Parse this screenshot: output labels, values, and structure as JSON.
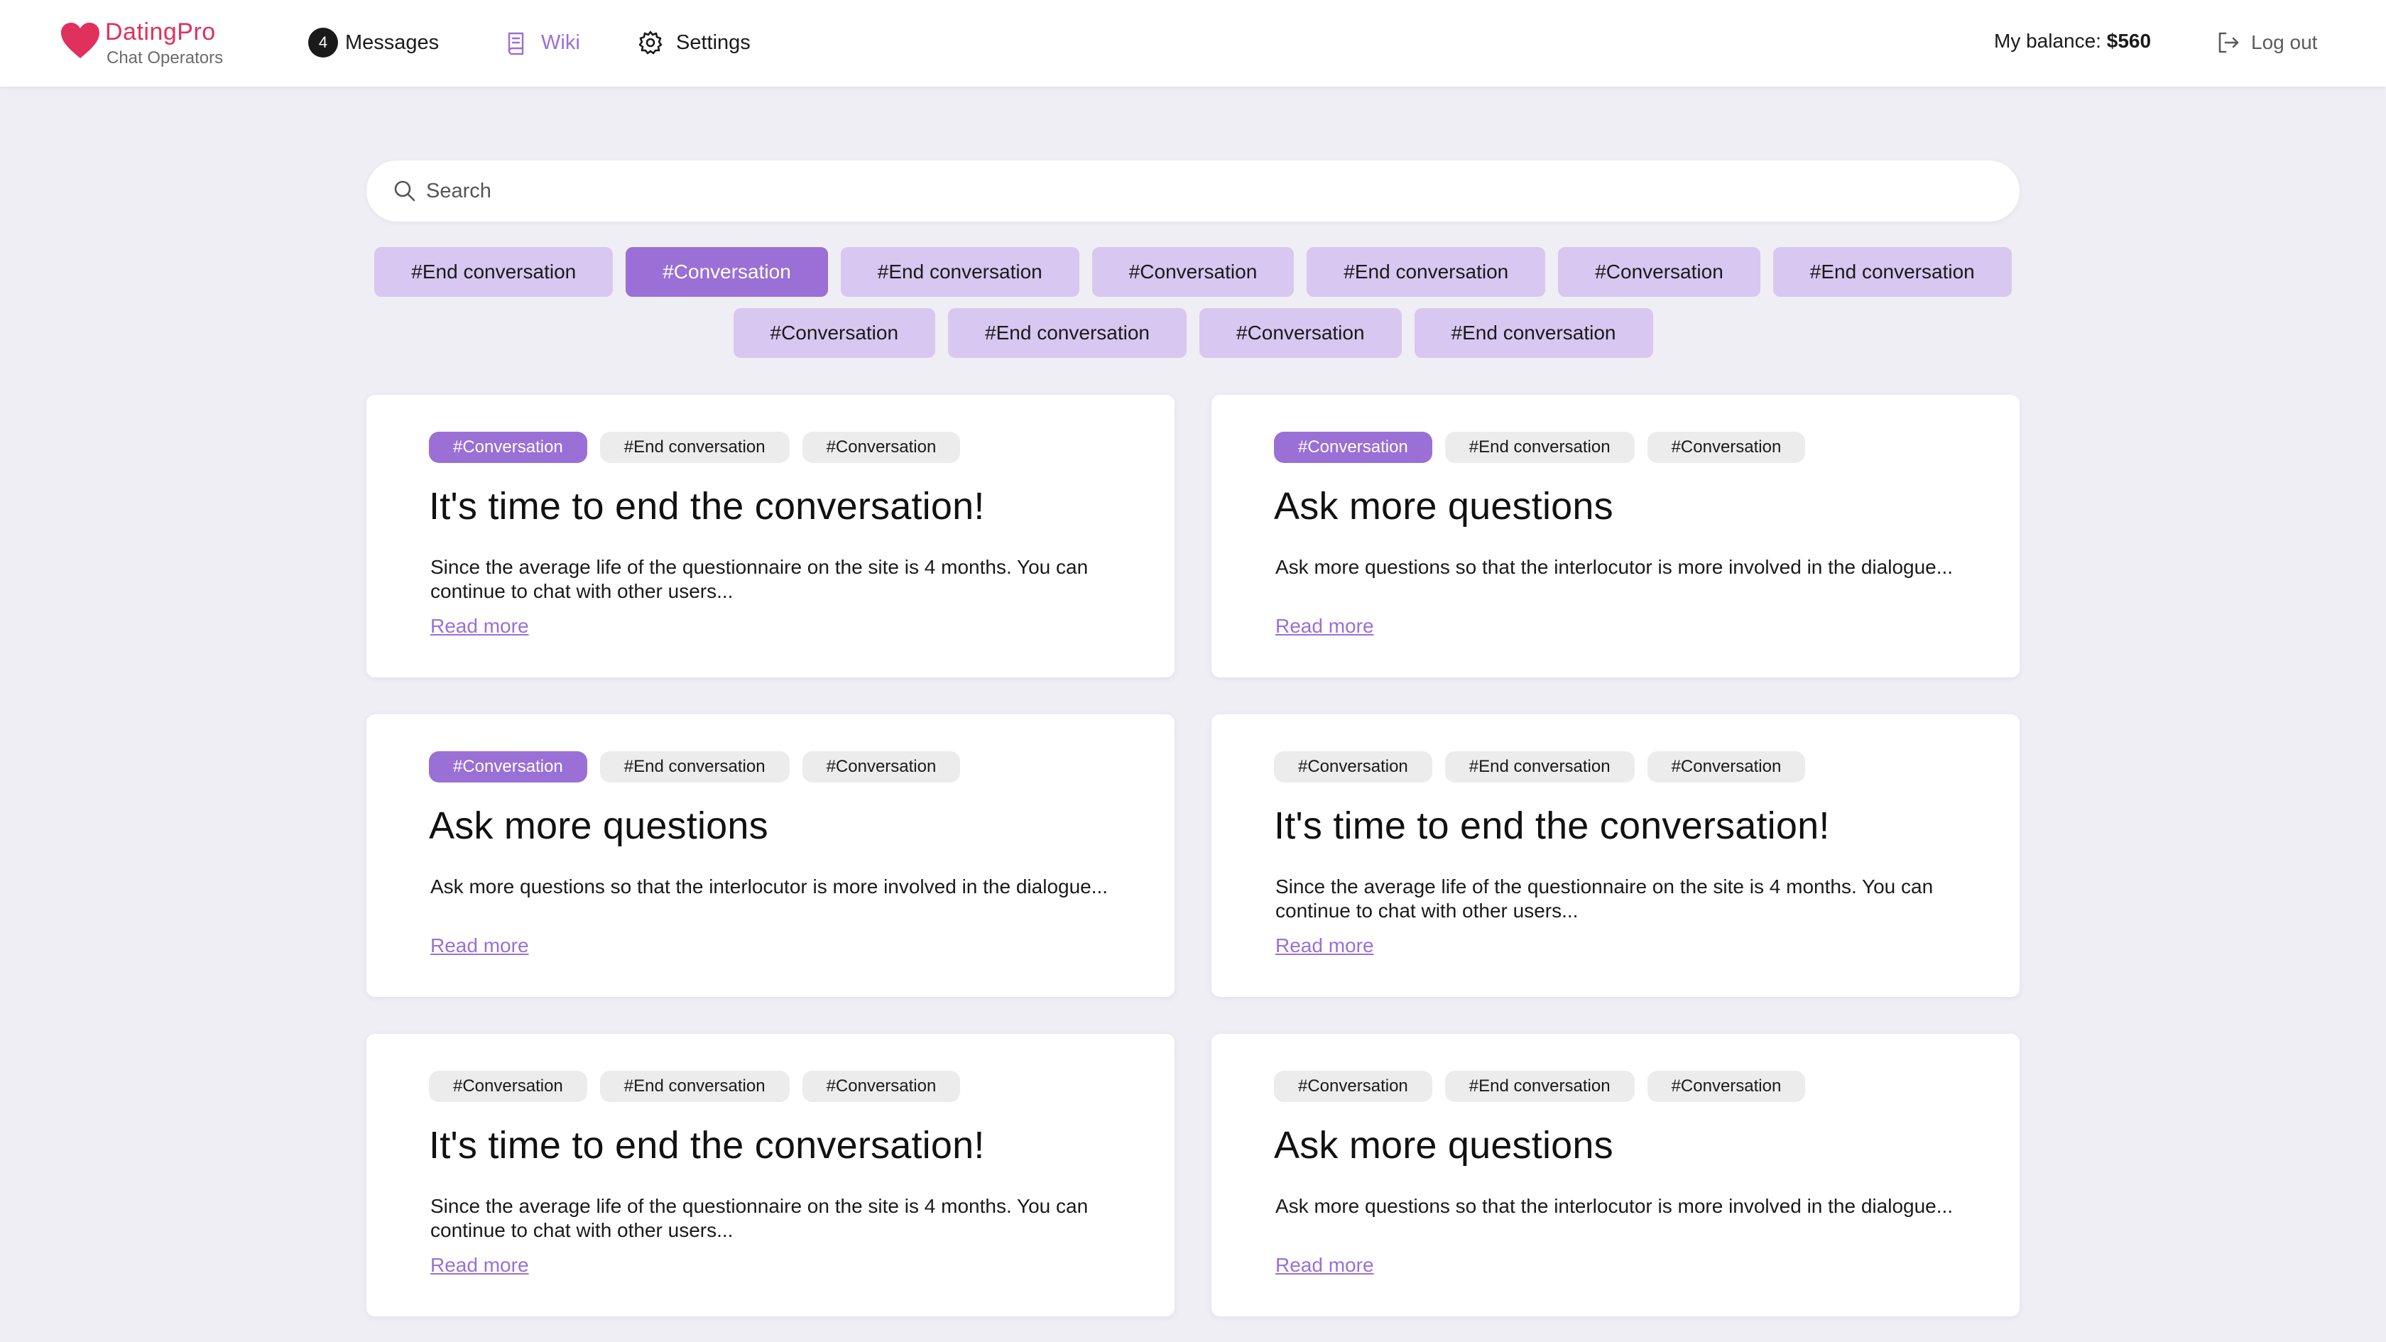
{
  "app": {
    "logo_name": "DatingPro",
    "logo_sub": "Chat Operators",
    "brand_color": "#e0305c",
    "accent_color": "#9a6fd6"
  },
  "nav": {
    "messages_count": "4",
    "messages_label": "Messages",
    "wiki_label": "Wiki",
    "settings_label": "Settings",
    "balance_label": "My balance:",
    "balance_value": "$560",
    "logout_label": "Log out"
  },
  "search": {
    "placeholder": "Search"
  },
  "filters": [
    {
      "label": "#End conversation",
      "active": false
    },
    {
      "label": "#Conversation",
      "active": true
    },
    {
      "label": "#End conversation",
      "active": false
    },
    {
      "label": "#Conversation",
      "active": false
    },
    {
      "label": "#End conversation",
      "active": false
    },
    {
      "label": "#Conversation",
      "active": false
    },
    {
      "label": "#End conversation",
      "active": false
    },
    {
      "label": "#Conversation",
      "active": false
    },
    {
      "label": "#End conversation",
      "active": false
    },
    {
      "label": "#Conversation",
      "active": false
    },
    {
      "label": "#End conversation",
      "active": false
    }
  ],
  "cards": [
    {
      "tags": [
        {
          "label": "#Conversation",
          "active": true
        },
        {
          "label": "#End conversation",
          "active": false
        },
        {
          "label": "#Conversation",
          "active": false
        }
      ],
      "title": "It's time to end the conversation!",
      "text": "Since the average life of the questionnaire on the site is 4 months. You can continue to chat with other users...",
      "link": "Read more"
    },
    {
      "tags": [
        {
          "label": "#Conversation",
          "active": true
        },
        {
          "label": "#End conversation",
          "active": false
        },
        {
          "label": "#Conversation",
          "active": false
        }
      ],
      "title": "Ask more questions",
      "text": "Ask more questions so that the interlocutor is more involved in the dialogue...",
      "link": "Read more"
    },
    {
      "tags": [
        {
          "label": "#Conversation",
          "active": true
        },
        {
          "label": "#End conversation",
          "active": false
        },
        {
          "label": "#Conversation",
          "active": false
        }
      ],
      "title": "Ask more questions",
      "text": "Ask more questions so that the interlocutor is more involved in the dialogue...",
      "link": "Read more"
    },
    {
      "tags": [
        {
          "label": "#Conversation",
          "active": false
        },
        {
          "label": "#End conversation",
          "active": false
        },
        {
          "label": "#Conversation",
          "active": false
        }
      ],
      "title": "It's time to end the conversation!",
      "text": "Since the average life of the questionnaire on the site is 4 months. You can continue to chat with other users...",
      "link": "Read more"
    },
    {
      "tags": [
        {
          "label": "#Conversation",
          "active": false
        },
        {
          "label": "#End conversation",
          "active": false
        },
        {
          "label": "#Conversation",
          "active": false
        }
      ],
      "title": "It's time to end the conversation!",
      "text": "Since the average life of the questionnaire on the site is 4 months. You can continue to chat with other users...",
      "link": "Read more"
    },
    {
      "tags": [
        {
          "label": "#Conversation",
          "active": false
        },
        {
          "label": "#End conversation",
          "active": false
        },
        {
          "label": "#Conversation",
          "active": false
        }
      ],
      "title": "Ask more questions",
      "text": "Ask more questions so that the interlocutor is more involved in the dialogue...",
      "link": "Read more"
    }
  ]
}
